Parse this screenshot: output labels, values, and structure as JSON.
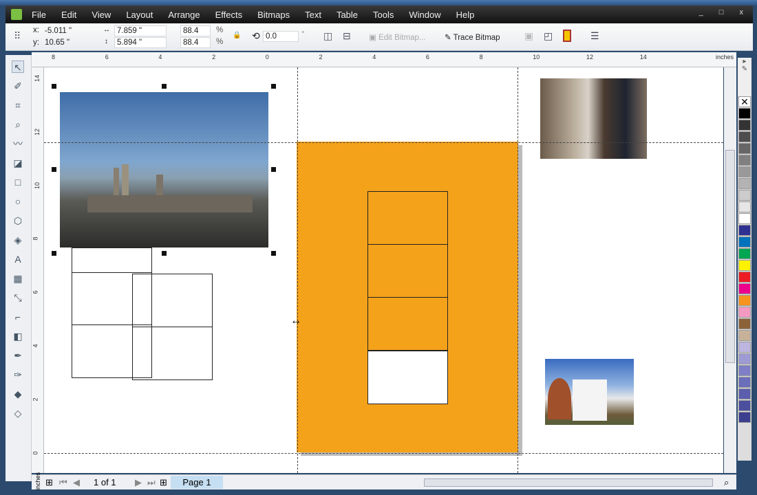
{
  "menu": [
    "File",
    "Edit",
    "View",
    "Layout",
    "Arrange",
    "Effects",
    "Bitmaps",
    "Text",
    "Table",
    "Tools",
    "Window",
    "Help"
  ],
  "window_controls": "_ □ x",
  "props": {
    "x_label": "x:",
    "x": "-5.011 \"",
    "y_label": "y:",
    "y": "10.65 \"",
    "width": "7.859 \"",
    "height": "5.894 \"",
    "scale_x": "88.4",
    "scale_y": "88.4",
    "pct": "%",
    "rotation": "0.0",
    "deg": "°",
    "edit_bitmap": "Edit Bitmap...",
    "trace_bitmap": "Trace Bitmap"
  },
  "ruler": {
    "units": "inches",
    "h_ticks": [
      "8",
      "6",
      "4",
      "2",
      "0",
      "2",
      "4",
      "6",
      "8",
      "10",
      "12",
      "14"
    ],
    "v_ticks": [
      "14",
      "12",
      "10",
      "8",
      "6",
      "4",
      "2",
      "0"
    ]
  },
  "status": {
    "page_count": "1 of 1",
    "page_tab": "Page 1"
  },
  "colors": {
    "orange": "#f5a21b",
    "palette": [
      "#000000",
      "#333333",
      "#4d4d4d",
      "#666666",
      "#808080",
      "#999999",
      "#b3b3b3",
      "#cccccc",
      "#e6e6e6",
      "#ffffff",
      "#2e3192",
      "#0072bc",
      "#00a651",
      "#fff200",
      "#ed1c24",
      "#ec008c",
      "#f7941d",
      "#f49ac1",
      "#8c6239",
      "#c7b299",
      "#bdb6e0",
      "#9e9bd4",
      "#7e7fc6",
      "#6b6fb9",
      "#5b5fae",
      "#4b4f9e",
      "#3b3f8e"
    ]
  }
}
